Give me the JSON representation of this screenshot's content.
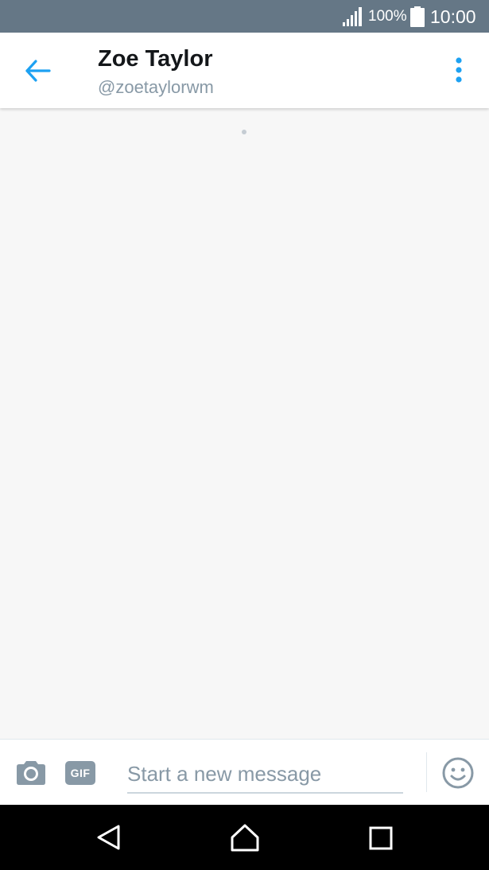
{
  "status_bar": {
    "battery_percent": "100%",
    "time": "10:00",
    "icons": [
      "signal-icon",
      "battery-icon"
    ]
  },
  "header": {
    "name": "Zoe Taylor",
    "handle": "@zoetaylorwm",
    "icons": [
      "back-arrow-icon",
      "overflow-menu-icon"
    ],
    "accent_color": "#1da1f2"
  },
  "composer": {
    "placeholder": "Start a new message",
    "gif_label": "GIF",
    "icons": [
      "camera-icon",
      "gif-icon",
      "emoji-icon"
    ]
  },
  "navigation_bar": {
    "icons": [
      "nav-back-icon",
      "nav-home-icon",
      "nav-recents-icon"
    ]
  },
  "colors": {
    "status_bar_bg": "#657786",
    "accent": "#1da1f2",
    "muted": "#8899a6",
    "background": "#f7f7f7"
  }
}
